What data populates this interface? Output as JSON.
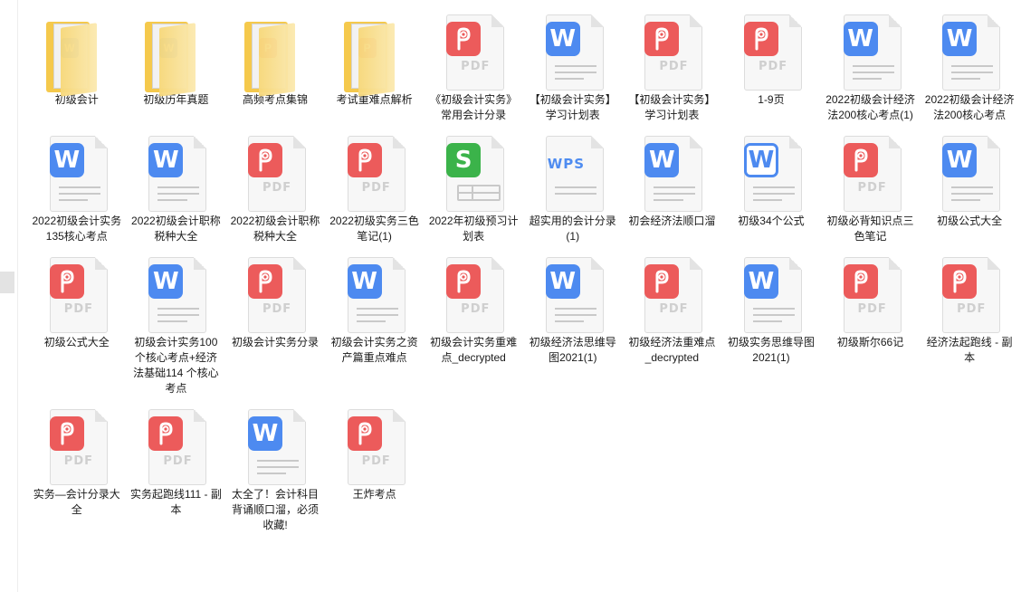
{
  "colors": {
    "pdf": "#ec5b5b",
    "word": "#4d8af0",
    "sheet": "#3bb34a",
    "folder": "#f5c94c"
  },
  "strings": {
    "pdf_mark": "PDF",
    "wps_mark": "WPS"
  },
  "files": [
    {
      "name": "初级会计",
      "type": "folder",
      "icon": "folder-word-icon"
    },
    {
      "name": "初级历年真题",
      "type": "folder",
      "icon": "folder-word-icon"
    },
    {
      "name": "高频考点集锦",
      "type": "folder",
      "icon": "folder-pdf-icon"
    },
    {
      "name": "考试重难点解析",
      "type": "folder",
      "icon": "folder-pdf-icon"
    },
    {
      "name": "《初级会计实务》常用会计分录",
      "type": "pdf",
      "icon": "pdf-file-icon"
    },
    {
      "name": "【初级会计实务】学习计划表",
      "type": "word",
      "icon": "word-file-icon"
    },
    {
      "name": "【初级会计实务】学习计划表",
      "type": "pdf",
      "icon": "pdf-file-icon"
    },
    {
      "name": "1-9页",
      "type": "pdf",
      "icon": "pdf-file-icon"
    },
    {
      "name": "2022初级会计经济法200核心考点(1)",
      "type": "word",
      "icon": "word-file-icon"
    },
    {
      "name": "2022初级会计经济法200核心考点",
      "type": "word",
      "icon": "word-file-icon"
    },
    {
      "name": "2022初级会计实务135核心考点",
      "type": "word",
      "icon": "word-file-icon"
    },
    {
      "name": "2022初级会计职称税种大全",
      "type": "word",
      "icon": "word-file-icon"
    },
    {
      "name": "2022初级会计职称税种大全",
      "type": "pdf",
      "icon": "pdf-file-icon"
    },
    {
      "name": "2022初级实务三色笔记(1)",
      "type": "pdf",
      "icon": "pdf-file-icon"
    },
    {
      "name": "2022年初级预习计划表",
      "type": "sheet",
      "icon": "sheet-file-icon"
    },
    {
      "name": "超实用的会计分录(1)",
      "type": "wps",
      "icon": "wps-file-icon"
    },
    {
      "name": "初会经济法顺口溜",
      "type": "word",
      "icon": "word-file-icon"
    },
    {
      "name": "初级34个公式",
      "type": "word-outline",
      "icon": "word-file-icon"
    },
    {
      "name": "初级必背知识点三色笔记",
      "type": "pdf",
      "icon": "pdf-file-icon"
    },
    {
      "name": "初级公式大全",
      "type": "word",
      "icon": "word-file-icon"
    },
    {
      "name": "初级公式大全",
      "type": "pdf",
      "icon": "pdf-file-icon"
    },
    {
      "name": "初级会计实务100 个核心考点+经济法基础114 个核心考点",
      "type": "word",
      "icon": "word-file-icon"
    },
    {
      "name": "初级会计实务分录",
      "type": "pdf",
      "icon": "pdf-file-icon"
    },
    {
      "name": "初级会计实务之资产篇重点难点",
      "type": "word",
      "icon": "word-file-icon"
    },
    {
      "name": "初级会计实务重难点_decrypted",
      "type": "pdf",
      "icon": "pdf-file-icon"
    },
    {
      "name": "初级经济法思维导图2021(1)",
      "type": "word",
      "icon": "word-file-icon"
    },
    {
      "name": "初级经济法重难点_decrypted",
      "type": "pdf",
      "icon": "pdf-file-icon"
    },
    {
      "name": "初级实务思维导图2021(1)",
      "type": "word",
      "icon": "word-file-icon"
    },
    {
      "name": "初级斯尔66记",
      "type": "pdf",
      "icon": "pdf-file-icon"
    },
    {
      "name": "经济法起跑线 - 副本",
      "type": "pdf",
      "icon": "pdf-file-icon"
    },
    {
      "name": "实务—会计分录大全",
      "type": "pdf",
      "icon": "pdf-file-icon"
    },
    {
      "name": "实务起跑线111 - 副本",
      "type": "pdf",
      "icon": "pdf-file-icon"
    },
    {
      "name": "太全了！会计科目背诵顺口溜，必须收藏!",
      "type": "word",
      "icon": "word-file-icon"
    },
    {
      "name": "王炸考点",
      "type": "pdf",
      "icon": "pdf-file-icon"
    }
  ]
}
